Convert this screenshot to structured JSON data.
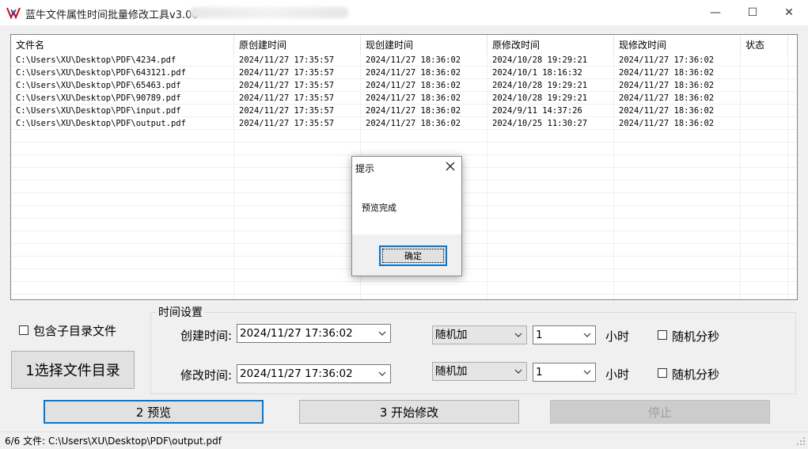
{
  "window": {
    "title": "蓝牛文件属性时间批量修改工具v3.00",
    "minimize_glyph": "—",
    "maximize_glyph": "☐",
    "close_glyph": "✕"
  },
  "table": {
    "columns": [
      "文件名",
      "原创建时间",
      "现创建时间",
      "原修改时间",
      "现修改时间",
      "状态"
    ],
    "rows": [
      [
        "C:\\Users\\XU\\Desktop\\PDF\\4234.pdf",
        "2024/11/27 17:35:57",
        "2024/11/27 18:36:02",
        "2024/10/28 19:29:21",
        "2024/11/27 17:36:02",
        ""
      ],
      [
        "C:\\Users\\XU\\Desktop\\PDF\\643121.pdf",
        "2024/11/27 17:35:57",
        "2024/11/27 18:36:02",
        "2024/10/1 18:16:32",
        "2024/11/27 18:36:02",
        ""
      ],
      [
        "C:\\Users\\XU\\Desktop\\PDF\\65463.pdf",
        "2024/11/27 17:35:57",
        "2024/11/27 18:36:02",
        "2024/10/28 19:29:21",
        "2024/11/27 18:36:02",
        ""
      ],
      [
        "C:\\Users\\XU\\Desktop\\PDF\\90789.pdf",
        "2024/11/27 17:35:57",
        "2024/11/27 18:36:02",
        "2024/10/28 19:29:21",
        "2024/11/27 18:36:02",
        ""
      ],
      [
        "C:\\Users\\XU\\Desktop\\PDF\\input.pdf",
        "2024/11/27 17:35:57",
        "2024/11/27 18:36:02",
        "2024/9/11 14:37:26",
        "2024/11/27 18:36:02",
        ""
      ],
      [
        "C:\\Users\\XU\\Desktop\\PDF\\output.pdf",
        "2024/11/27 17:35:57",
        "2024/11/27 18:36:02",
        "2024/10/25 11:30:27",
        "2024/11/27 18:36:02",
        ""
      ]
    ]
  },
  "options": {
    "include_subdirs_label": "包含子目录文件",
    "select_dir_button": "1选择文件目录"
  },
  "time_settings": {
    "legend": "时间设置",
    "create_label": "创建时间:",
    "create_value": "2024/11/27 17:36:02",
    "create_mode": "随机加",
    "create_amount": "1",
    "create_unit": "小时",
    "create_random_label": "随机分秒",
    "modify_label": "修改时间:",
    "modify_value": "2024/11/27 17:36:02",
    "modify_mode": "随机加",
    "modify_amount": "1",
    "modify_unit": "小时",
    "modify_random_label": "随机分秒"
  },
  "actions": {
    "preview": "2 预览",
    "start": "3 开始修改",
    "stop": "停止"
  },
  "status": {
    "text": "6/6 文件: C:\\Users\\XU\\Desktop\\PDF\\output.pdf"
  },
  "dialog": {
    "title": "提示",
    "message": "预览完成",
    "ok": "确定"
  },
  "colors": {
    "accent": "#0078d7",
    "icon_red": "#d0021b",
    "icon_blue": "#1e5bb8"
  }
}
